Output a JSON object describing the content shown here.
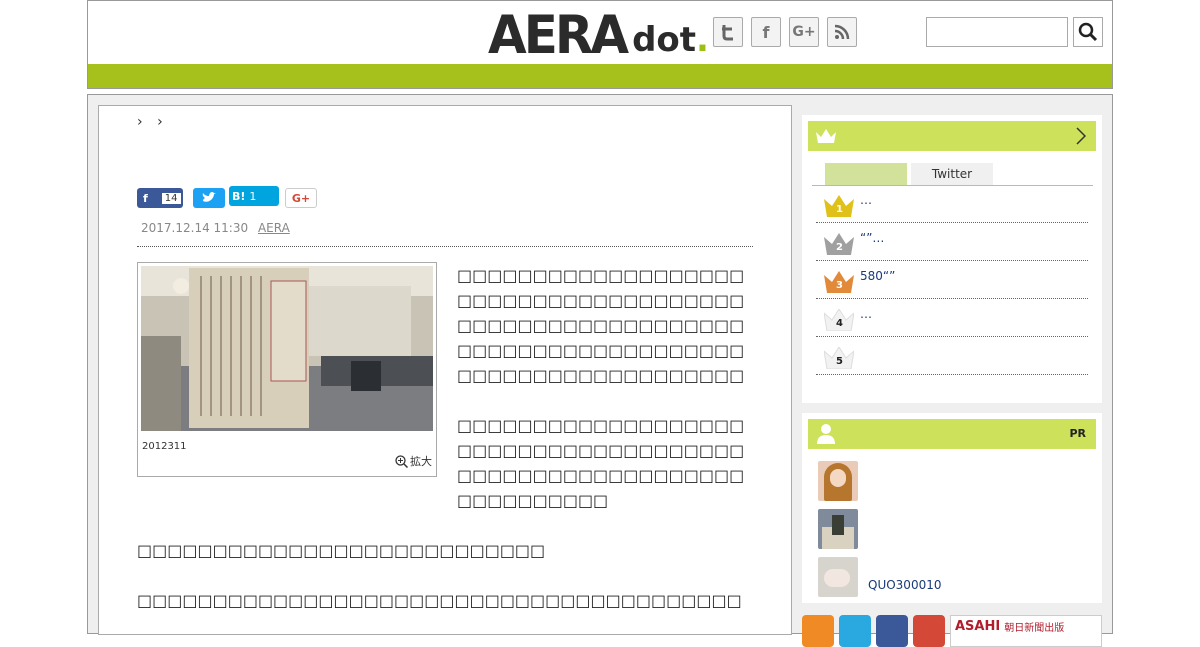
{
  "header": {
    "logo_main": "AERA",
    "logo_sub_dot": "dot",
    "logo_sub_period": "."
  },
  "social_buttons": [
    {
      "name": "twitter",
      "glyph": "t"
    },
    {
      "name": "facebook",
      "glyph": "f"
    },
    {
      "name": "google-plus",
      "glyph": "G+"
    },
    {
      "name": "rss",
      "glyph": ""
    }
  ],
  "search": {
    "value": "",
    "placeholder": ""
  },
  "article": {
    "breadcrumb": [
      "",
      ""
    ],
    "share": {
      "facebook_count": "14",
      "hatena_label": "B!",
      "hatena_count": "1",
      "gplus_label": "G+"
    },
    "date": "2017.12.14 11:30",
    "source": "AERA",
    "photo_caption": "2012311",
    "zoom_label": "拡大",
    "paragraphs": [
      "□□□□□□□□□□□□□□□□□□□□□□□□□□□□□□□□□□□□□□□□□□□□□□□□□□□□□□□□□□□□□□□□□□□□□□□□□□□□□□□□□□□□□□□□□□□□□□□□□□□□□",
      "□□□□□□□□□□□□□□□□□□□□□□□□□□□□□□□□□□□□□□□□□□□□□□□□□□□□□□□□□□□□□□□□□□□",
      "□□□□□□□□□□□□□□□□□□□□□□□□□□□",
      "□□□□□□□□□□□□□□□□□□□□□□□□□□□□□□□□□□□□□□□□□□□□□□□□□"
    ]
  },
  "sidebar": {
    "ranking": {
      "tabs": [
        "",
        "Twitter"
      ],
      "items": [
        {
          "rank": "1",
          "text": "…"
        },
        {
          "rank": "2",
          "text": "“”…"
        },
        {
          "rank": "3",
          "text": "580“”"
        },
        {
          "rank": "4",
          "text": "…"
        },
        {
          "rank": "5",
          "text": ""
        }
      ]
    },
    "pr": {
      "label": "PR",
      "items": [
        {
          "text": ""
        },
        {
          "text": ""
        },
        {
          "text": "QUO300010"
        }
      ]
    }
  },
  "footer": {
    "publisher_label": "ASAHI",
    "publisher_sub": "朝日新聞出版"
  },
  "colors": {
    "accent_green": "#a7c11c",
    "light_green": "#cde15a",
    "link_blue": "#1a3a7a",
    "gold": "#e0c11a",
    "silver": "#a0a0a0",
    "bronze": "#e08a3a"
  }
}
